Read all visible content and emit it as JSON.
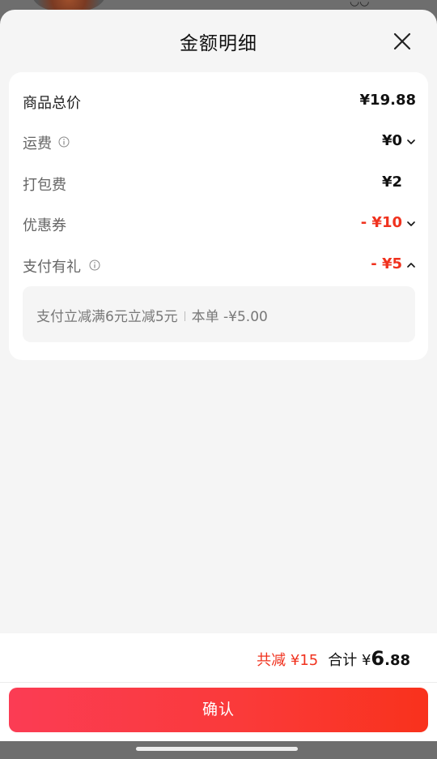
{
  "sheet": {
    "title": "金额明细"
  },
  "rows": [
    {
      "label": "商品总价",
      "value": "¥19.88",
      "emphasis": true,
      "info": false,
      "chevron": "none",
      "color": "#111111"
    },
    {
      "label": "运费",
      "value": "¥0",
      "emphasis": false,
      "info": true,
      "chevron": "down",
      "color": "#111111"
    },
    {
      "label": "打包费",
      "value": "¥2",
      "emphasis": false,
      "info": false,
      "chevron": "none",
      "color": "#111111"
    },
    {
      "label": "优惠券",
      "value": "- ¥10",
      "emphasis": false,
      "info": false,
      "chevron": "down",
      "color": "#f0321e"
    },
    {
      "label": "支付有礼",
      "value": "- ¥5",
      "emphasis": false,
      "info": true,
      "chevron": "up",
      "color": "#f0321e"
    }
  ],
  "payment_gift_detail": {
    "text": "支付立减满6元立减5元",
    "order_label": "本单 -¥5.00"
  },
  "footer": {
    "discount_label": "共减 ¥15",
    "total_label": "合计 ¥",
    "total_integer": "6",
    "total_decimal": ".88",
    "confirm_label": "确认"
  },
  "icons": {
    "close": "close-icon",
    "info": "info-icon",
    "chevron_down": "chevron-down-icon",
    "chevron_up": "chevron-up-icon"
  },
  "colors": {
    "accent_red": "#f0321e",
    "button_gradient_start": "#fb3c54",
    "button_gradient_end": "#f9321c",
    "sheet_background": "#f5f5f5",
    "card_background": "#ffffff"
  }
}
